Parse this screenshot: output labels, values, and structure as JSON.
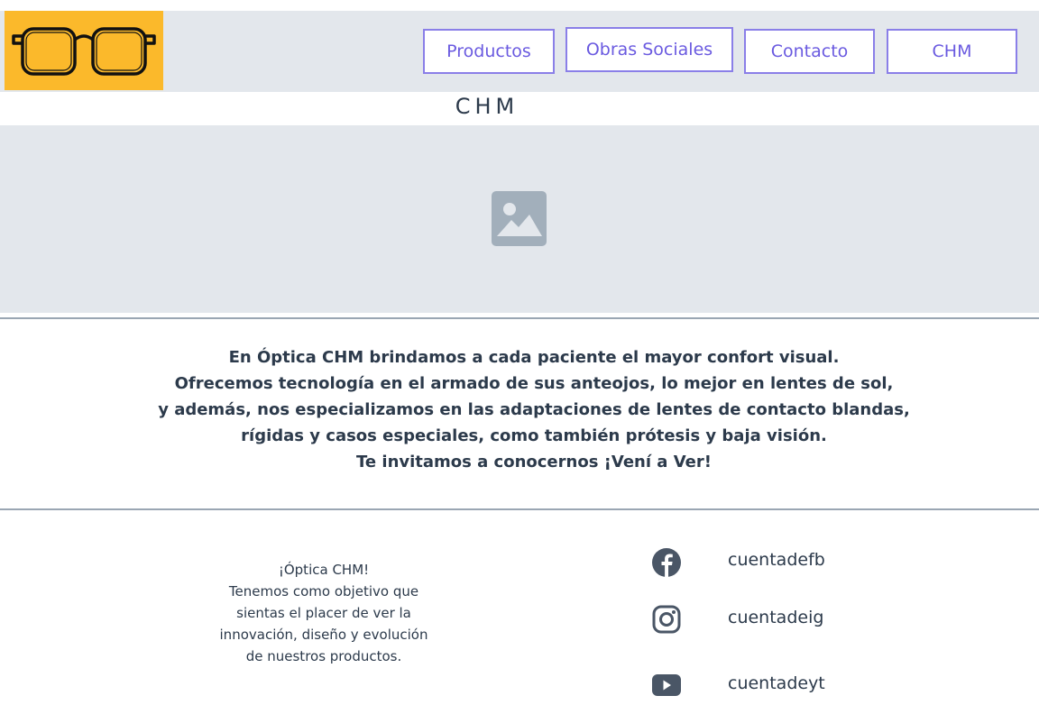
{
  "header": {
    "logo": "glasses-logo",
    "nav": [
      {
        "label": "Productos"
      },
      {
        "label": "Obras Sociales"
      },
      {
        "label": "Contacto"
      },
      {
        "label": "CHM"
      }
    ]
  },
  "page_title": "CHM",
  "hero": {
    "icon": "image-placeholder-icon"
  },
  "about": {
    "lines": [
      "En Óptica CHM brindamos a cada paciente el mayor confort visual.",
      "Ofrecemos tecnología en el armado de sus anteojos, lo mejor en lentes de sol,",
      "y además, nos especializamos en las adaptaciones de lentes de contacto blandas,",
      "rígidas y casos especiales, como también prótesis y baja visión.",
      "Te invitamos a conocernos ¡Vení a Ver!"
    ]
  },
  "footer": {
    "tagline_lines": [
      "¡Óptica CHM!",
      "Tenemos como objetivo que",
      "sientas el placer de ver la",
      "innovación, diseño y evolución",
      "de nuestros productos."
    ],
    "social": [
      {
        "icon": "facebook-icon",
        "label": "cuentadefb"
      },
      {
        "icon": "instagram-icon",
        "label": "cuentadeig"
      },
      {
        "icon": "youtube-icon",
        "label": "cuentadeyt"
      }
    ]
  },
  "colors": {
    "header_bg": "#e3e7ec",
    "logo_bg": "#fbb92b",
    "nav_border": "#8a7fe8",
    "nav_text": "#6a5ae0",
    "text": "#2c3a4b",
    "icon": "#4a5666",
    "placeholder_icon": "#a2afbb"
  }
}
